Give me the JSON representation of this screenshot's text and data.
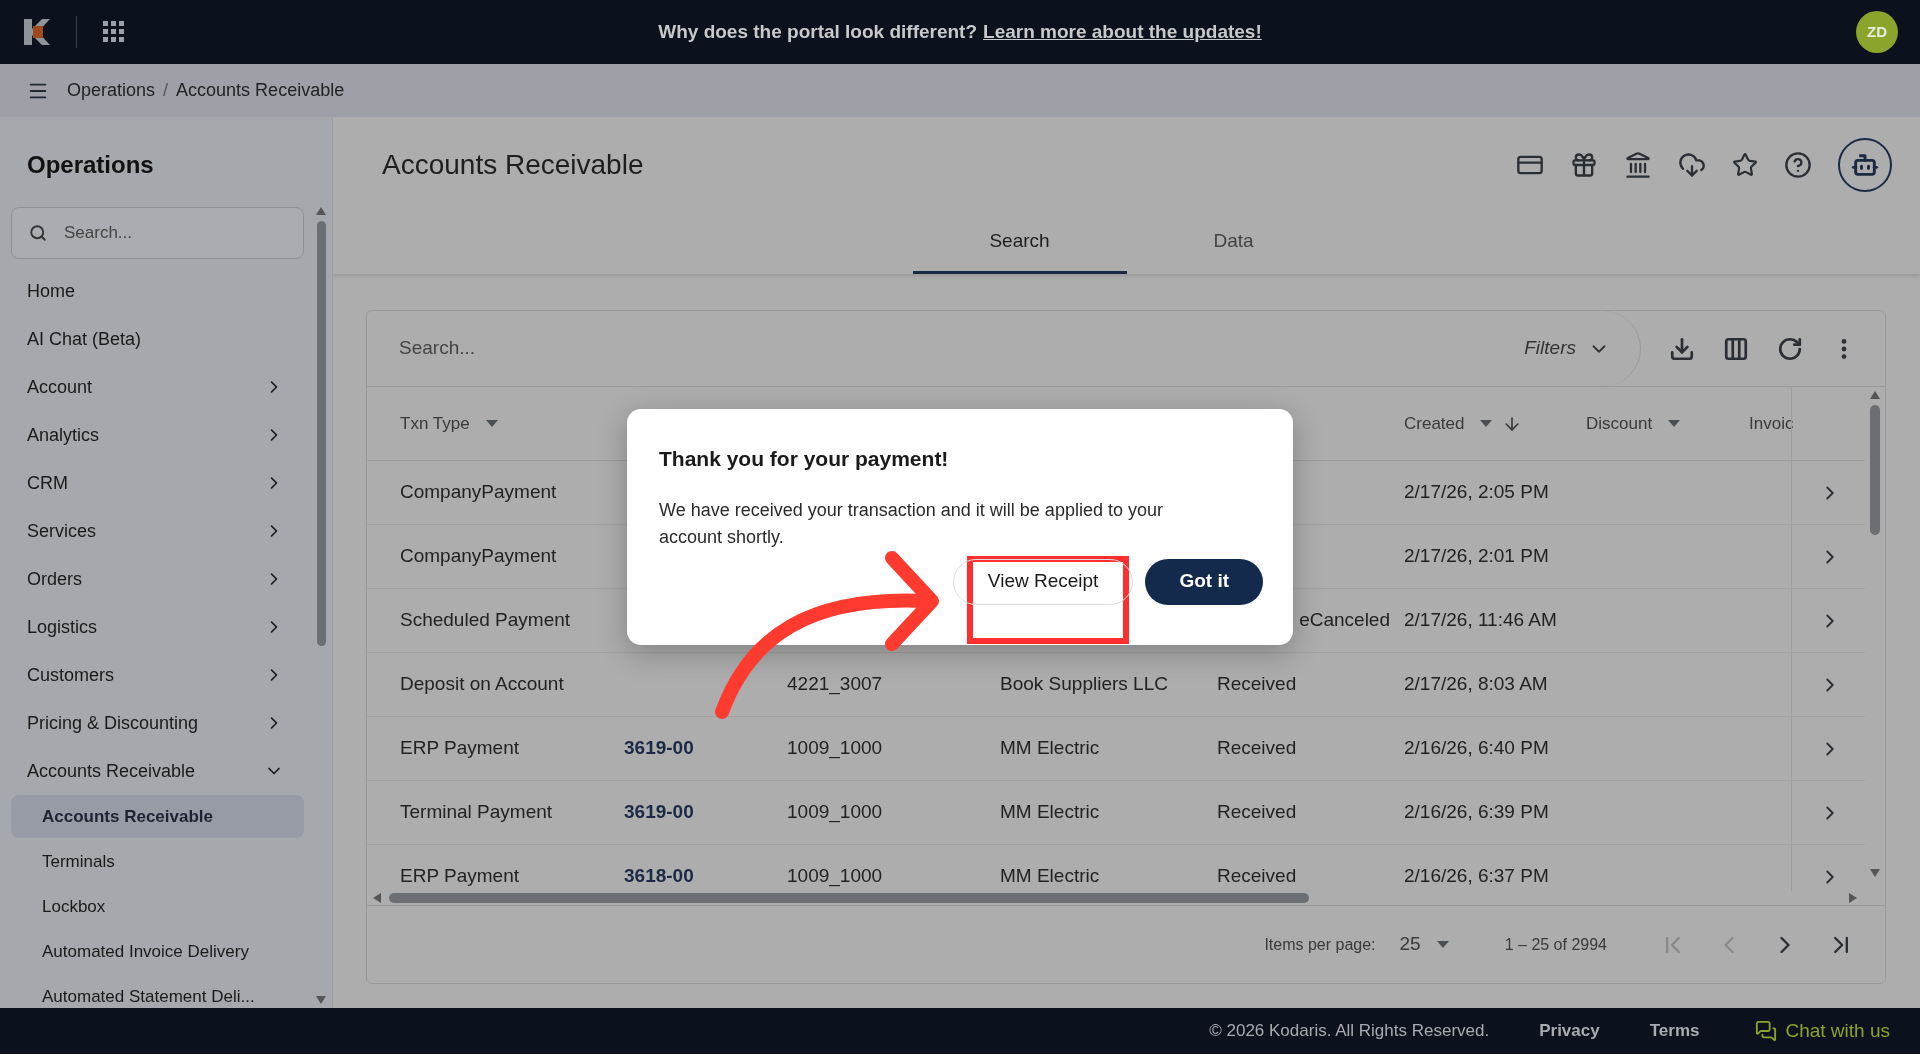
{
  "top_bar": {
    "banner_text": "Why does the portal look different?",
    "banner_link": "Learn more about the updates!",
    "avatar": "ZD"
  },
  "breadcrumb": [
    "Operations",
    "Accounts Receivable"
  ],
  "breadcrumb_separator": "/",
  "sidebar": {
    "title": "Operations",
    "search_placeholder": "Search...",
    "items": [
      {
        "label": "Home",
        "kind": "link"
      },
      {
        "label": "AI Chat (Beta)",
        "kind": "link"
      },
      {
        "label": "Account",
        "kind": "group",
        "expanded": false
      },
      {
        "label": "Analytics",
        "kind": "group",
        "expanded": false
      },
      {
        "label": "CRM",
        "kind": "group",
        "expanded": false
      },
      {
        "label": "Services",
        "kind": "group",
        "expanded": false
      },
      {
        "label": "Orders",
        "kind": "group",
        "expanded": false
      },
      {
        "label": "Logistics",
        "kind": "group",
        "expanded": false
      },
      {
        "label": "Customers",
        "kind": "group",
        "expanded": false
      },
      {
        "label": "Pricing & Discounting",
        "kind": "group",
        "expanded": false
      },
      {
        "label": "Accounts Receivable",
        "kind": "group",
        "expanded": true,
        "children": [
          {
            "label": "Accounts Receivable",
            "selected": true
          },
          {
            "label": "Terminals",
            "selected": false
          },
          {
            "label": "Lockbox",
            "selected": false
          },
          {
            "label": "Automated Invoice Delivery",
            "selected": false
          },
          {
            "label": "Automated Statement Deli...",
            "selected": false
          }
        ]
      }
    ]
  },
  "page": {
    "title": "Accounts Receivable",
    "tabs": [
      {
        "label": "Search",
        "selected": true
      },
      {
        "label": "Data",
        "selected": false
      }
    ]
  },
  "table": {
    "search_placeholder": "Search...",
    "filters": "Filters",
    "columns": [
      {
        "label": "Txn Type",
        "sort_menu": true,
        "sorted": false
      },
      null,
      null,
      null,
      null,
      {
        "label": "Created",
        "sort_menu": true,
        "sorted": true
      },
      {
        "label": "Discount",
        "sort_menu": true,
        "sorted": false
      },
      {
        "label": "Invoic"
      }
    ],
    "rows": [
      {
        "cells": [
          "CompanyPayment",
          "",
          "",
          "",
          "",
          "2/17/26, 2:05 PM",
          "",
          ""
        ]
      },
      {
        "cells": [
          "CompanyPayment",
          "",
          "",
          "",
          "",
          "2/17/26, 2:01 PM",
          "",
          ""
        ]
      },
      {
        "cells": [
          "Scheduled Payment",
          "",
          "",
          "",
          "eCanceled",
          "2/17/26, 11:46 AM",
          "",
          ""
        ]
      },
      {
        "cells": [
          "Deposit on Account",
          "",
          "4221_3007",
          "Book Suppliers LLC",
          "Received",
          "2/17/26, 8:03 AM",
          "",
          ""
        ]
      },
      {
        "cells": [
          "ERP Payment",
          "3619-00",
          "1009_1000",
          "MM Electric",
          "Received",
          "2/16/26, 6:40 PM",
          "",
          ""
        ]
      },
      {
        "cells": [
          "Terminal Payment",
          "3619-00",
          "1009_1000",
          "MM Electric",
          "Received",
          "2/16/26, 6:39 PM",
          "",
          ""
        ]
      },
      {
        "cells": [
          "ERP Payment",
          "3618-00",
          "1009_1000",
          "MM Electric",
          "Received",
          "2/16/26, 6:37 PM",
          "",
          ""
        ]
      }
    ],
    "pagination": {
      "items_label": "Items per page:",
      "page_size": "25",
      "range": "1 – 25 of 2994",
      "first_disabled": true,
      "prev_disabled": true
    }
  },
  "dialog": {
    "title": "Thank you for your payment!",
    "message": "We have received your transaction and it will be applied to your account shortly.",
    "secondary": "View Receipt",
    "primary": "Got it"
  },
  "footer": {
    "copyright": "© 2026 Kodaris. All Rights Reserved.",
    "links": [
      "Privacy",
      "Terms"
    ],
    "chat": "Chat with us"
  }
}
